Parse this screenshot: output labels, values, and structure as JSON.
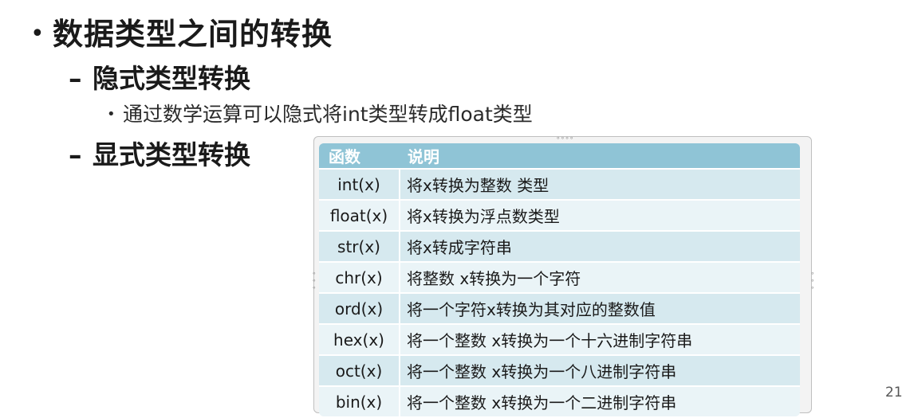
{
  "slide": {
    "bullet1": "数据类型之间的转换",
    "sub1": "隐式类型转换",
    "sub1_detail": "通过数学运算可以隐式将int类型转成float类型",
    "sub2": "显式类型转换",
    "page_number": "21"
  },
  "table": {
    "headers": [
      "函数",
      "说明"
    ],
    "rows": [
      {
        "fn": "int(x)",
        "desc": "将x转换为整数 类型"
      },
      {
        "fn": "float(x)",
        "desc": "将x转换为浮点数类型"
      },
      {
        "fn": "str(x)",
        "desc": "将x转成字符串"
      },
      {
        "fn": "chr(x)",
        "desc": "将整数 x转换为一个字符"
      },
      {
        "fn": "ord(x)",
        "desc": "将一个字符x转换为其对应的整数值"
      },
      {
        "fn": "hex(x)",
        "desc": "将一个整数 x转换为一个十六进制字符串"
      },
      {
        "fn": "oct(x)",
        "desc": "将一个整数 x转换为一个八进制字符串"
      },
      {
        "fn": "bin(x)",
        "desc": "将一个整数 x转换为一个二进制字符串"
      }
    ]
  }
}
